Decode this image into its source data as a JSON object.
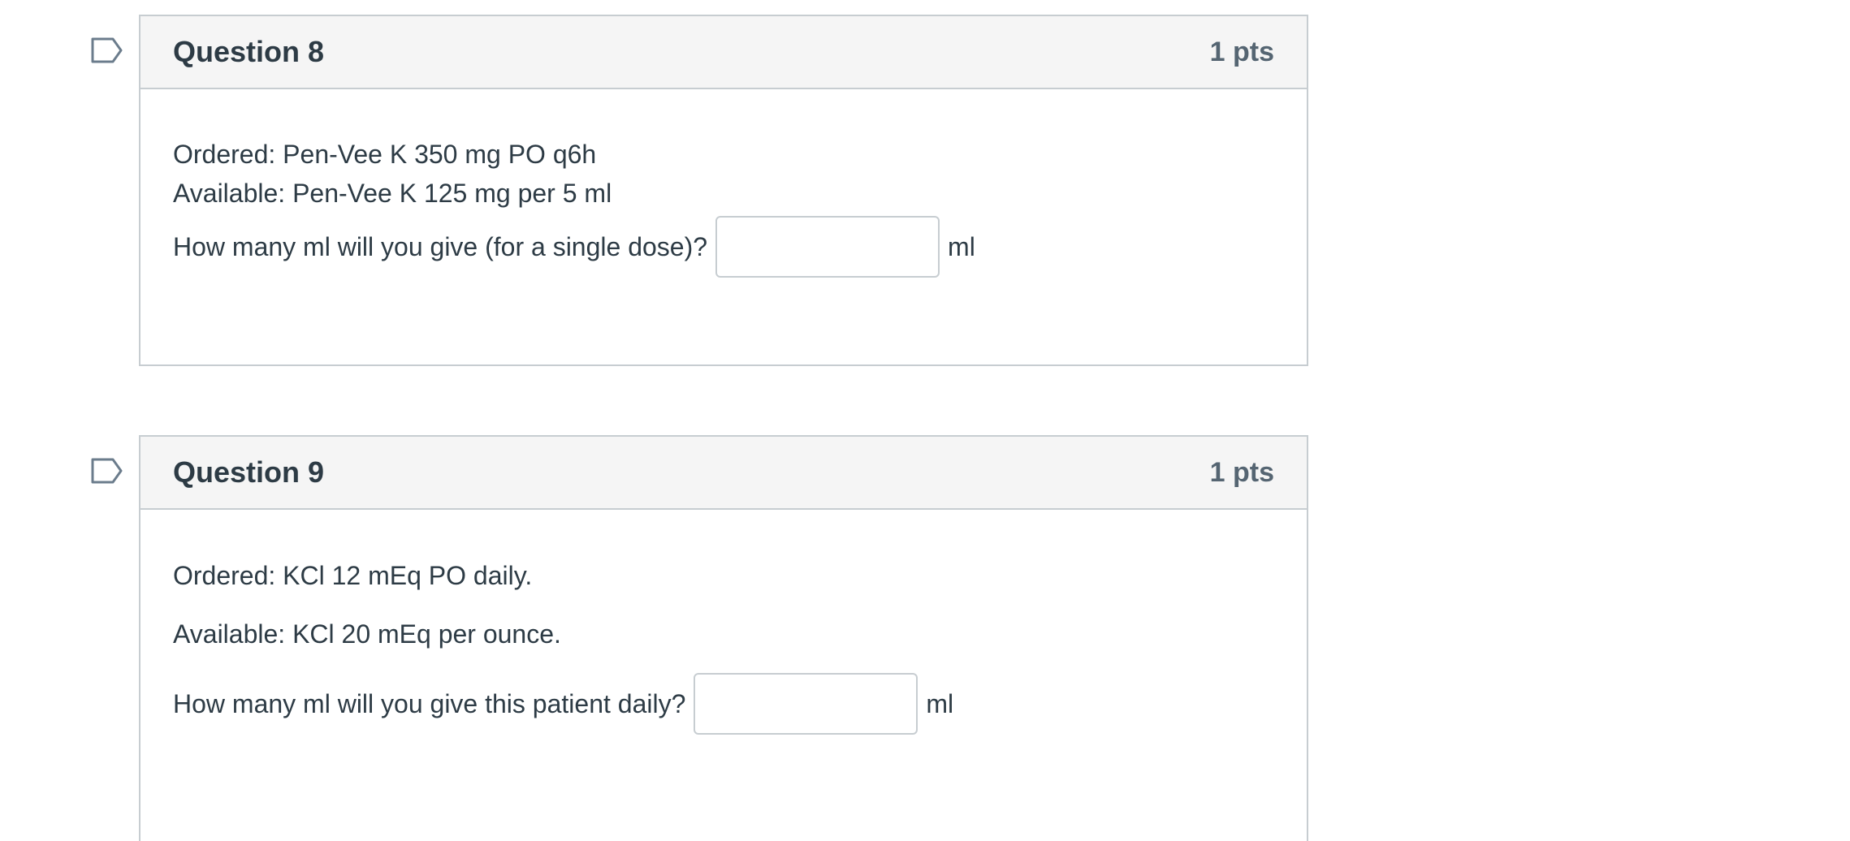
{
  "questions": [
    {
      "title": "Question 8",
      "points": "1 pts",
      "lines": [
        "Ordered: Pen-Vee K 350 mg PO q6h",
        "Available: Pen-Vee K 125 mg per 5 ml"
      ],
      "prompt": "How many ml will you give (for a single dose)?",
      "answer_value": "",
      "unit": "ml"
    },
    {
      "title": "Question 9",
      "points": "1 pts",
      "lines": [
        "Ordered: KCl 12 mEq PO daily.",
        "Available: KCl 20 mEq per ounce."
      ],
      "prompt": "How many ml will you give this patient daily?",
      "answer_value": "",
      "unit": "ml"
    }
  ],
  "icons": {
    "flag": "flag-icon"
  },
  "colors": {
    "header_bg": "#f5f5f5",
    "border": "#c7cdd1",
    "text": "#2d3b45",
    "points_text": "#556572",
    "flag_stroke": "#6b7c8c"
  }
}
